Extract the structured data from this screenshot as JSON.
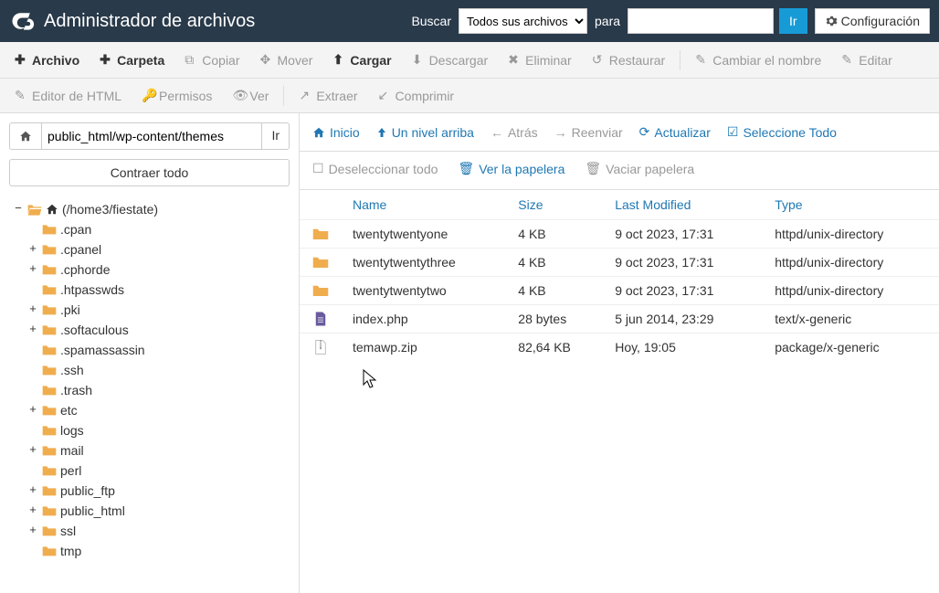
{
  "header": {
    "title": "Administrador de archivos",
    "search_label": "Buscar",
    "search_for_label": "para",
    "search_select_options": [
      "Todos sus archivos"
    ],
    "search_select_value": "Todos sus archivos",
    "search_input_value": "",
    "go_label": "Ir",
    "config_label": "Configuración"
  },
  "toolbar": {
    "archivo": "Archivo",
    "carpeta": "Carpeta",
    "copiar": "Copiar",
    "mover": "Mover",
    "cargar": "Cargar",
    "descargar": "Descargar",
    "eliminar": "Eliminar",
    "restaurar": "Restaurar",
    "renombrar": "Cambiar el nombre",
    "editar": "Editar",
    "html_editor": "Editor de HTML",
    "permisos": "Permisos",
    "ver": "Ver",
    "extraer": "Extraer",
    "comprimir": "Comprimir"
  },
  "left": {
    "path_value": "public_html/wp-content/themes",
    "go_label": "Ir",
    "collapse_label": "Contraer todo",
    "root_label": "(/home3/fiestate)",
    "nodes": [
      {
        "label": ".cpan",
        "expandable": false
      },
      {
        "label": ".cpanel",
        "expandable": true
      },
      {
        "label": ".cphorde",
        "expandable": true
      },
      {
        "label": ".htpasswds",
        "expandable": false
      },
      {
        "label": ".pki",
        "expandable": true
      },
      {
        "label": ".softaculous",
        "expandable": true
      },
      {
        "label": ".spamassassin",
        "expandable": false
      },
      {
        "label": ".ssh",
        "expandable": false
      },
      {
        "label": ".trash",
        "expandable": false
      },
      {
        "label": "etc",
        "expandable": true
      },
      {
        "label": "logs",
        "expandable": false
      },
      {
        "label": "mail",
        "expandable": true
      },
      {
        "label": "perl",
        "expandable": false
      },
      {
        "label": "public_ftp",
        "expandable": true
      },
      {
        "label": "public_html",
        "expandable": true
      },
      {
        "label": "ssl",
        "expandable": true
      },
      {
        "label": "tmp",
        "expandable": false
      }
    ]
  },
  "filebar": {
    "inicio": "Inicio",
    "up": "Un nivel arriba",
    "atras": "Atrás",
    "reenviar": "Reenviar",
    "actualizar": "Actualizar",
    "select_all": "Seleccione Todo",
    "deselect_all": "Deseleccionar todo",
    "view_trash": "Ver la papelera",
    "empty_trash": "Vaciar papelera"
  },
  "table": {
    "headers": {
      "name": "Name",
      "size": "Size",
      "lastmod": "Last Modified",
      "type": "Type"
    },
    "rows": [
      {
        "icon": "folder",
        "name": "twentytwentyone",
        "size": "4 KB",
        "lastmod": "9 oct 2023, 17:31",
        "type": "httpd/unix-directory"
      },
      {
        "icon": "folder",
        "name": "twentytwentythree",
        "size": "4 KB",
        "lastmod": "9 oct 2023, 17:31",
        "type": "httpd/unix-directory"
      },
      {
        "icon": "folder",
        "name": "twentytwentytwo",
        "size": "4 KB",
        "lastmod": "9 oct 2023, 17:31",
        "type": "httpd/unix-directory"
      },
      {
        "icon": "file-doc",
        "name": "index.php",
        "size": "28 bytes",
        "lastmod": "5 jun 2014, 23:29",
        "type": "text/x-generic"
      },
      {
        "icon": "file-zip",
        "name": "temawp.zip",
        "size": "82,64 KB",
        "lastmod": "Hoy, 19:05",
        "type": "package/x-generic"
      }
    ]
  }
}
